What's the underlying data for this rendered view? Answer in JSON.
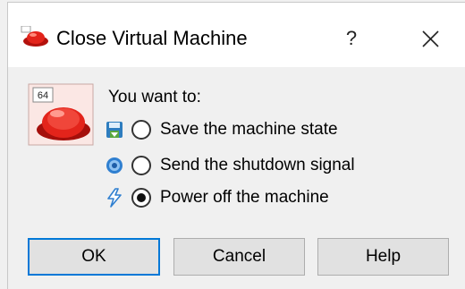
{
  "window": {
    "title": "Close Virtual Machine",
    "help_label": "?",
    "close_icon": "close-icon"
  },
  "prompt": "You want to:",
  "app_icon": {
    "name": "virtualbox-64bit-icon",
    "badge": "64"
  },
  "options": [
    {
      "label": "Save the machine state",
      "icon": "save-state-icon",
      "checked": false
    },
    {
      "label": "Send the shutdown signal",
      "icon": "shutdown-signal-icon",
      "checked": false
    },
    {
      "label": "Power off the machine",
      "icon": "power-off-icon",
      "checked": true
    }
  ],
  "buttons": {
    "ok": "OK",
    "cancel": "Cancel",
    "help": "Help"
  },
  "colors": {
    "accent": "#0078d7",
    "dialog_bg": "#f0f0f0",
    "titlebar_bg": "#ffffff"
  }
}
